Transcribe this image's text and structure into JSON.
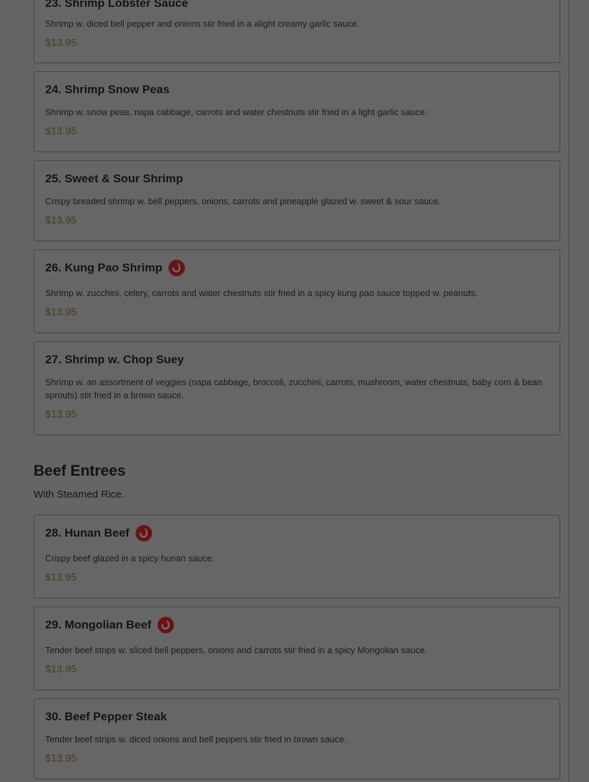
{
  "items_top": [
    {
      "title": "23. Shrimp Lobster Sauce",
      "description": "Shrimp w. diced bell pepper and onions stir fried in a alight creamy garlic sauce.",
      "price": "$13.95",
      "spicy": false
    },
    {
      "title": "24. Shrimp Snow Peas",
      "description": "Shrimp w. snow peas, napa cabbage, carrots and water chestnuts stir fried in a light garlic sauce.",
      "price": "$13.95",
      "spicy": false
    },
    {
      "title": "25. Sweet & Sour Shrimp",
      "description": "Crispy breaded shrimp w. bell peppers, onions, carrots and pineapple glazed w. sweet & sour sauce.",
      "price": "$13.95",
      "spicy": false
    },
    {
      "title": "26. Kung Pao Shrimp",
      "description": "Shrimp w. zucchini, celery, carrots and water chestnuts stir fried in a spicy kung pao sauce topped w. peanuts.",
      "price": "$13.95",
      "spicy": true
    },
    {
      "title": "27. Shrimp w. Chop Suey",
      "description": "Shrimp w. an assortment of veggies (napa cabbage, broccoli, zucchini, carrots, mushroom, water chestnuts, baby corn & bean sprouts) stir fried in a brown sauce.",
      "price": "$13.95",
      "spicy": false
    }
  ],
  "section": {
    "title": "Beef Entrees",
    "subtitle": "With Steamed Rice."
  },
  "items_beef": [
    {
      "title": "28. Hunan Beef",
      "description": "Crispy beef glazed in a spicy hunan sauce.",
      "price": "$13.95",
      "spicy": true
    },
    {
      "title": "29. Mongolian Beef",
      "description": "Tender beef strips w. sliced bell peppers, onions and carrots stir fried in a spicy Mongolian sauce.",
      "price": "$13.95",
      "spicy": true
    },
    {
      "title": "30. Beef Pepper Steak",
      "description": "Tender beef strips w. diced onions and bell peppers stir fried in brown sauce.",
      "price": "$13.95",
      "spicy": false
    }
  ],
  "colors": {
    "overlay_bg": "#656565",
    "spicy_badge": "#6b1313",
    "price_text": "#4a3a1a"
  },
  "icons": {
    "spicy": "chili-pepper-icon"
  }
}
